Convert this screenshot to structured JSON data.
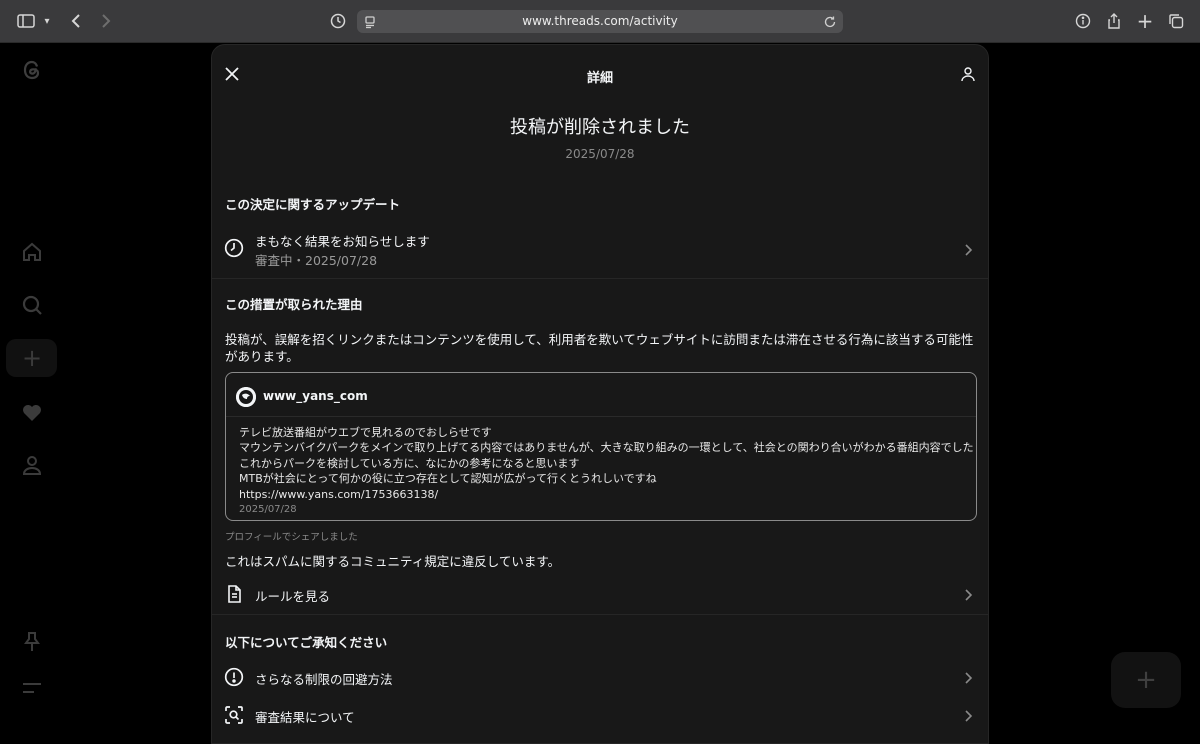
{
  "browser": {
    "url": "www.threads.com/activity"
  },
  "modal": {
    "title": "詳細",
    "heading": "投稿が削除されました",
    "date": "2025/07/28",
    "update_section": {
      "title": "この決定に関するアップデート",
      "item": {
        "label": "まもなく結果をお知らせします",
        "sublabel": "審査中・2025/07/28"
      }
    },
    "reason_section": {
      "title": "この措置が取られた理由",
      "text": "投稿が、誤解を招くリンクまたはコンテンツを使用して、利用者を欺いてウェブサイトに訪問または滞在させる行為に該当する可能性があります。"
    },
    "post": {
      "username": "www_yans_com",
      "lines": [
        "テレビ放送番組がウエブで見れるのでおしらせです",
        "マウンテンバイクパークをメインで取り上げてる内容ではありませんが、大きな取り組みの一環として、社会との関わり合いがわかる番組内容でした",
        "これからパークを検討している方に、なにかの参考になると思います",
        "MTBが社会にとって何かの役に立つ存在として認知が広がって行くとうれしいですね",
        "https://www.yans.com/1753663138/"
      ],
      "date": "2025/07/28"
    },
    "shared_note": "プロフィールでシェアしました",
    "violation": "これはスパムに関するコミュニティ規定に違反しています。",
    "rules_item": {
      "label": "ルールを見る"
    },
    "notice_section": {
      "title": "以下についてご承知ください",
      "items": [
        {
          "label": "さらなる制限の回避方法",
          "icon": "exclamation-circle-icon"
        },
        {
          "label": "審査結果について",
          "icon": "search-scan-icon"
        }
      ]
    }
  }
}
